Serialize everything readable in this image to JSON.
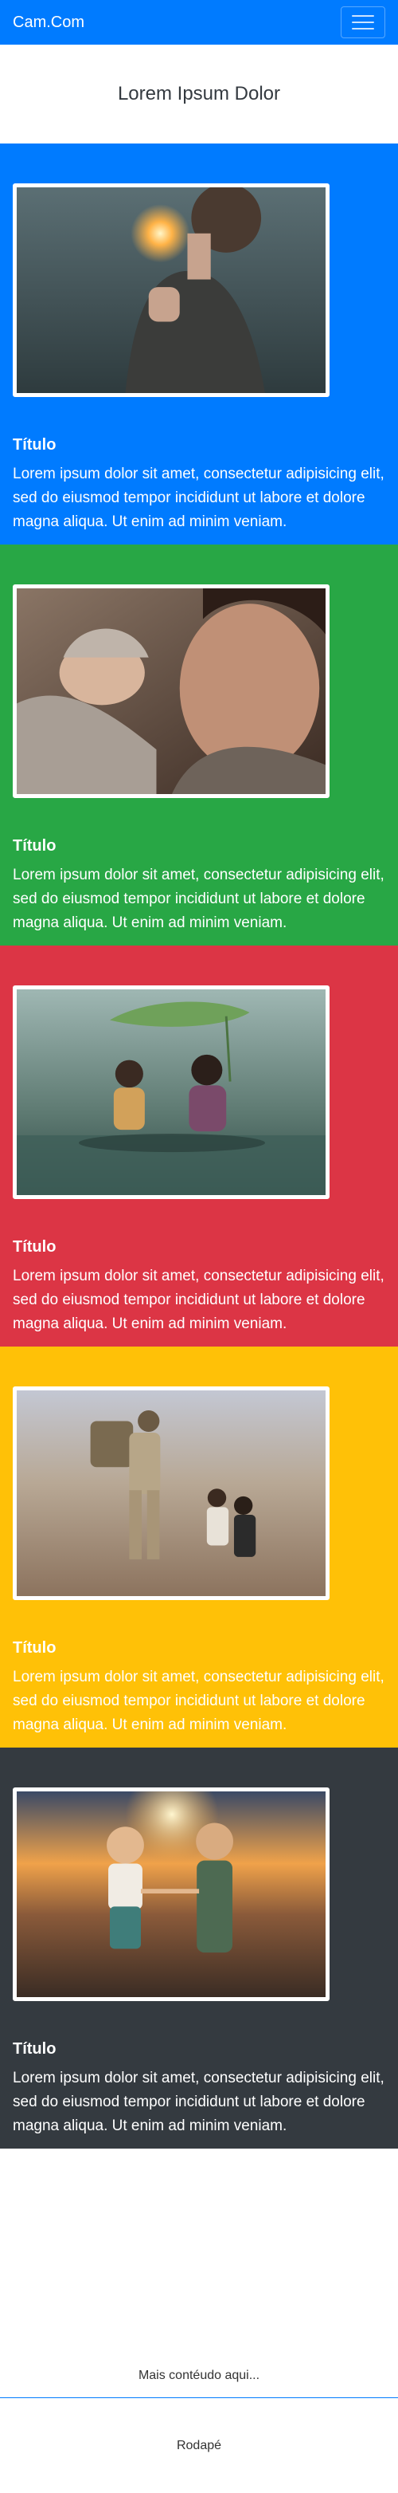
{
  "navbar": {
    "brand": "Cam.Com",
    "menu_icon": "hamburger-menu-icon"
  },
  "hero": {
    "title": "Lorem Ipsum Dolor"
  },
  "sections": [
    {
      "color": "#007bff",
      "image": "woman-with-sparkler-photo",
      "title": "Título",
      "text": "Lorem ipsum dolor sit amet, consectetur adipisicing elit, sed do eiusmod tempor incididunt ut labore et dolore magna aliqua. Ut enim ad minim veniam."
    },
    {
      "color": "#28a745",
      "image": "father-and-baby-photo",
      "title": "Título",
      "text": "Lorem ipsum dolor sit amet, consectetur adipisicing elit, sed do eiusmod tempor incididunt ut labore et dolore magna aliqua. Ut enim ad minim veniam."
    },
    {
      "color": "#dc3545",
      "image": "children-under-leaf-photo",
      "title": "Título",
      "text": "Lorem ipsum dolor sit amet, consectetur adipisicing elit, sed do eiusmod tempor incididunt ut labore et dolore magna aliqua. Ut enim ad minim veniam."
    },
    {
      "color": "#ffc107",
      "image": "soldier-and-children-photo",
      "title": "Título",
      "text": "Lorem ipsum dolor sit amet, consectetur adipisicing elit, sed do eiusmod tempor incididunt ut labore et dolore magna aliqua. Ut enim ad minim veniam."
    },
    {
      "color": "#343a40",
      "image": "two-kids-holding-hands-photo",
      "title": "Título",
      "text": "Lorem ipsum dolor sit amet, consectetur adipisicing elit, sed do eiusmod tempor incididunt ut labore et dolore magna aliqua. Ut enim ad minim veniam."
    }
  ],
  "more_content": "Mais contéudo aqui...",
  "footer": {
    "text": "Rodapé"
  }
}
